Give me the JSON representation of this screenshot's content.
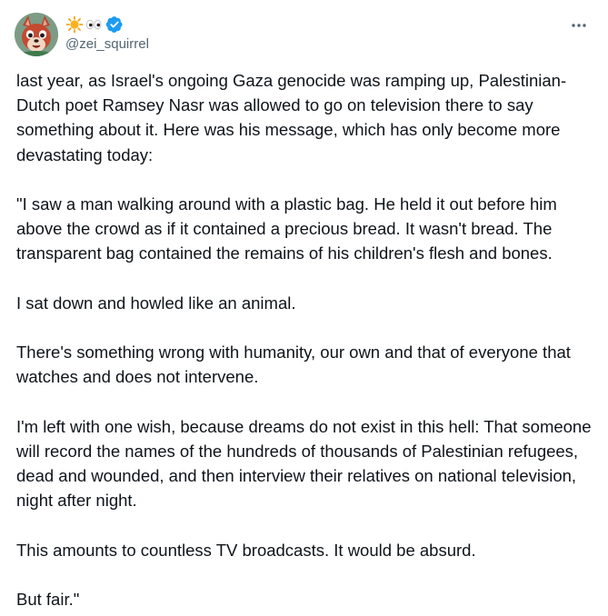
{
  "author": {
    "display_name_emojis": [
      "sun-emoji",
      "eyes-emoji"
    ],
    "verified": true,
    "handle": "@zei_squirrel",
    "avatar": "red-squirrel-cartoon-avatar"
  },
  "menu": {
    "icon": "more-horizontal-icon"
  },
  "tweet": {
    "paragraphs": [
      "last year, as Israel's ongoing Gaza genocide was ramping up, Palestinian-Dutch poet Ramsey Nasr was allowed to go on television there to say something about it. Here was his message, which has only become more devastating today:",
      "\"I saw a man walking around with a plastic bag. He held it out before him above the crowd as if it contained a precious bread. It wasn't bread. The transparent bag contained the remains of his children's flesh and bones.",
      "I sat down and howled like an animal.",
      "There's something wrong with humanity, our own and that of everyone that watches and does not intervene.",
      "I'm left with one wish, because dreams do not exist in this hell: That someone will record the names of the hundreds of thousands of Palestinian refugees, dead and wounded, and then interview their relatives on national television, night after night.",
      "This amounts to countless TV broadcasts. It would be absurd.",
      "But fair.\""
    ]
  },
  "colors": {
    "text": "#0f1419",
    "secondary": "#536471",
    "verified": "#1d9bf0",
    "avatar_bg": "#6f8f7a"
  }
}
